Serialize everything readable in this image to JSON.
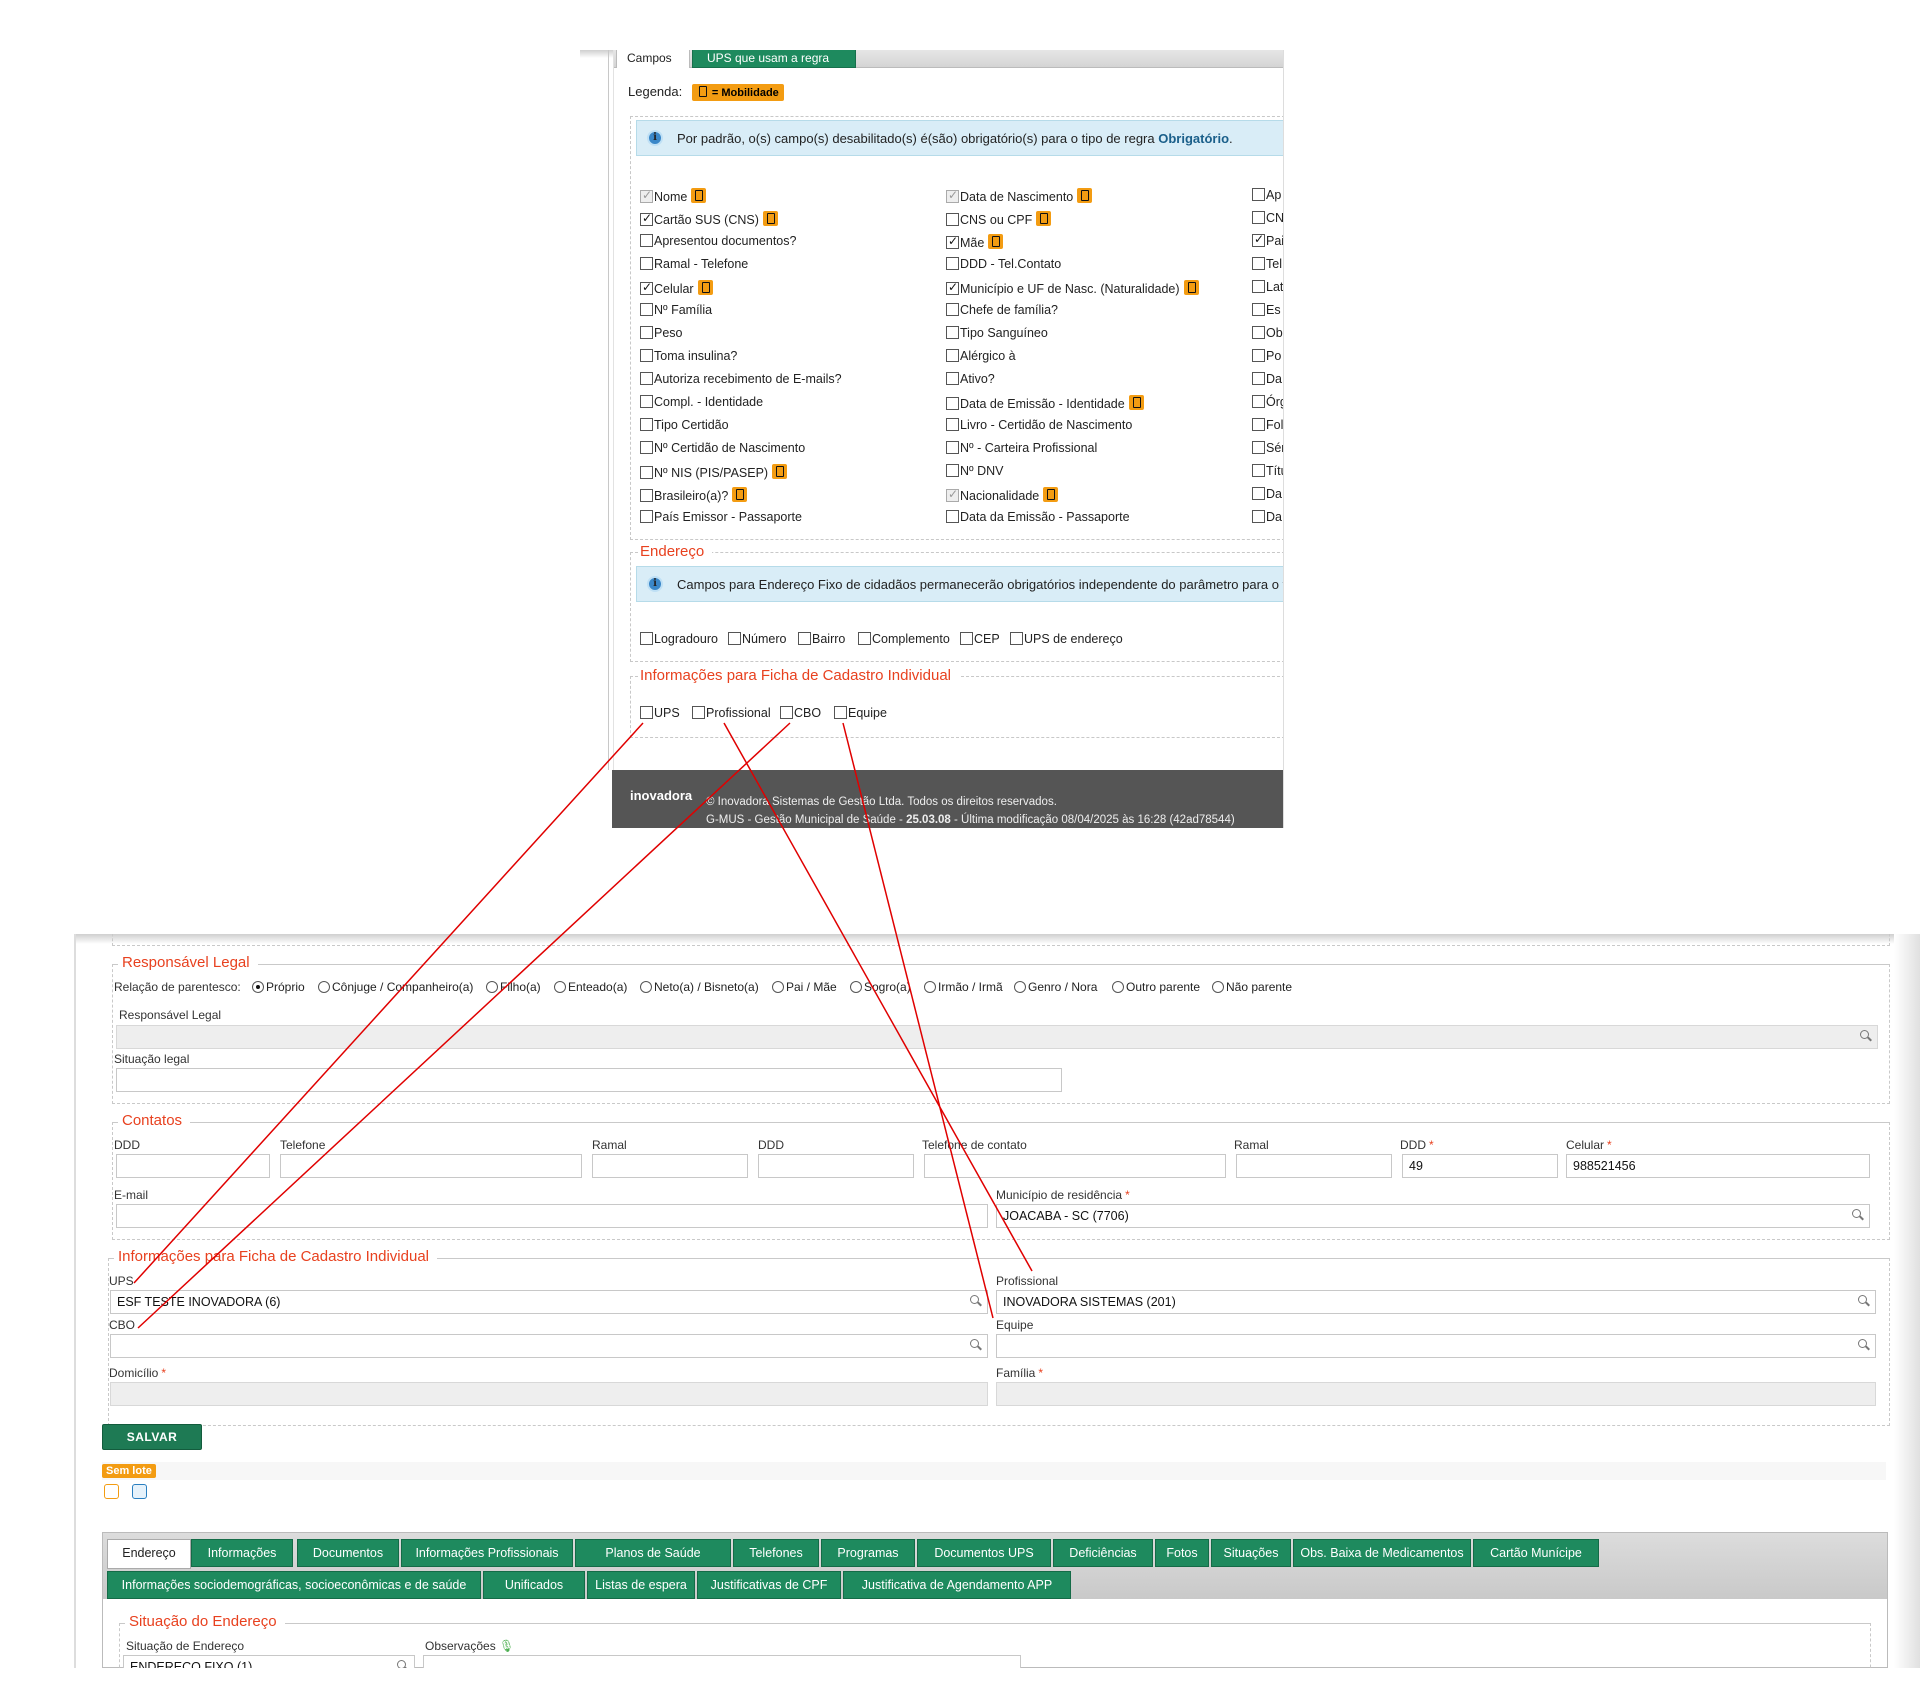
{
  "top": {
    "tabs": [
      {
        "label": "Campos"
      },
      {
        "label": "UPS que usam a regra"
      }
    ],
    "legenda_label": "Legenda:",
    "legenda_badge": "= Mobilidade",
    "info1_text": "Por padrão, o(s) campo(s) desabilitado(s) é(são) obrigatório(s) para o tipo de regra ",
    "info1_bold": "Obrigatório",
    "info1_end": ".",
    "col1": [
      {
        "label": "Nome",
        "checked": true,
        "disabled": true,
        "mob": true
      },
      {
        "label": "Cartão SUS (CNS)",
        "checked": true,
        "disabled": false,
        "mob": true
      },
      {
        "label": "Apresentou documentos?",
        "checked": false,
        "disabled": false,
        "mob": false
      },
      {
        "label": "Ramal - Telefone",
        "checked": false,
        "disabled": false,
        "mob": false
      },
      {
        "label": "Celular",
        "checked": true,
        "disabled": false,
        "mob": true
      },
      {
        "label": "Nº Família",
        "checked": false,
        "disabled": false,
        "mob": false
      },
      {
        "label": "Peso",
        "checked": false,
        "disabled": false,
        "mob": false
      },
      {
        "label": "Toma insulina?",
        "checked": false,
        "disabled": false,
        "mob": false
      },
      {
        "label": "Autoriza recebimento de E-mails?",
        "checked": false,
        "disabled": false,
        "mob": false
      },
      {
        "label": "Compl. - Identidade",
        "checked": false,
        "disabled": false,
        "mob": false
      },
      {
        "label": "Tipo Certidão",
        "checked": false,
        "disabled": false,
        "mob": false
      },
      {
        "label": "Nº Certidão de Nascimento",
        "checked": false,
        "disabled": false,
        "mob": false
      },
      {
        "label": "Nº NIS (PIS/PASEP)",
        "checked": false,
        "disabled": false,
        "mob": true
      },
      {
        "label": "Brasileiro(a)?",
        "checked": false,
        "disabled": false,
        "mob": true
      },
      {
        "label": "País Emissor - Passaporte",
        "checked": false,
        "disabled": false,
        "mob": false
      }
    ],
    "col2": [
      {
        "label": "Data de Nascimento",
        "checked": true,
        "disabled": true,
        "mob": true
      },
      {
        "label": "CNS ou CPF",
        "checked": false,
        "disabled": false,
        "mob": true
      },
      {
        "label": "Mãe",
        "checked": true,
        "disabled": false,
        "mob": true
      },
      {
        "label": "DDD - Tel.Contato",
        "checked": false,
        "disabled": false,
        "mob": false
      },
      {
        "label": "Município e UF de Nasc. (Naturalidade)",
        "checked": true,
        "disabled": false,
        "mob": true
      },
      {
        "label": "Chefe de família?",
        "checked": false,
        "disabled": false,
        "mob": false
      },
      {
        "label": "Tipo Sanguíneo",
        "checked": false,
        "disabled": false,
        "mob": false
      },
      {
        "label": "Alérgico à",
        "checked": false,
        "disabled": false,
        "mob": false
      },
      {
        "label": "Ativo?",
        "checked": false,
        "disabled": false,
        "mob": false
      },
      {
        "label": "Data de Emissão - Identidade",
        "checked": false,
        "disabled": false,
        "mob": true
      },
      {
        "label": "Livro - Certidão de Nascimento",
        "checked": false,
        "disabled": false,
        "mob": false
      },
      {
        "label": "Nº - Carteira Profissional",
        "checked": false,
        "disabled": false,
        "mob": false
      },
      {
        "label": "Nº DNV",
        "checked": false,
        "disabled": false,
        "mob": false
      },
      {
        "label": "Nacionalidade",
        "checked": true,
        "disabled": true,
        "mob": true
      },
      {
        "label": "Data da Emissão - Passaporte",
        "checked": false,
        "disabled": false,
        "mob": false
      }
    ],
    "col3": [
      {
        "label": "Ap",
        "checked": false
      },
      {
        "label": "CN",
        "checked": false
      },
      {
        "label": "Pai",
        "checked": true
      },
      {
        "label": "Tel",
        "checked": false
      },
      {
        "label": "Lat",
        "checked": false
      },
      {
        "label": "Es",
        "checked": false
      },
      {
        "label": "Ob",
        "checked": false
      },
      {
        "label": "Po",
        "checked": false
      },
      {
        "label": "Da",
        "checked": false
      },
      {
        "label": "Órg",
        "checked": false
      },
      {
        "label": "Fol",
        "checked": false
      },
      {
        "label": "Sér",
        "checked": false
      },
      {
        "label": "Títu",
        "checked": false
      },
      {
        "label": "Da",
        "checked": false
      },
      {
        "label": "Da",
        "checked": false
      }
    ],
    "endereco_title": "Endereço",
    "info2_text": "Campos para Endereço Fixo de cidadãos permanecerão obrigatórios independente do parâmetro para o t",
    "endereco_fields": [
      "Logradouro",
      "Número",
      "Bairro",
      "Complemento",
      "CEP",
      "UPS de endereço"
    ],
    "ficha_title": "Informações para Ficha de Cadastro Individual",
    "ficha_fields": [
      "UPS",
      "Profissional",
      "CBO",
      "Equipe"
    ],
    "footer_logo": "inovadora",
    "footer_line1": "© Inovadora Sistemas de Gestão Ltda. Todos os direitos reservados.",
    "footer_line2_a": "G-MUS - Gestão Municipal de Saúde - ",
    "footer_line2_b": "25.03.08",
    "footer_line2_c": " - Última modificação 08/04/2025 às 16:28 (42ad78544)"
  },
  "bottom": {
    "responsavel": {
      "title": "Responsável Legal",
      "relacao_label": "Relação de parentesco:",
      "options": [
        "Próprio",
        "Cônjuge / Companheiro(a)",
        "Filho(a)",
        "Enteado(a)",
        "Neto(a) / Bisneto(a)",
        "Pai / Mãe",
        "Sogro(a)",
        "Irmão / Irmã",
        "Genro / Nora",
        "Outro parente",
        "Não parente"
      ],
      "selected": "Próprio",
      "resp_label": "Responsável Legal",
      "situacao_label": "Situação legal"
    },
    "contatos": {
      "title": "Contatos",
      "ddd1_label": "DDD",
      "telefone_label": "Telefone",
      "ramal1_label": "Ramal",
      "ddd2_label": "DDD",
      "tel_contato_label": "Telefone de contato",
      "ramal2_label": "Ramal",
      "ddd3_label": "DDD",
      "ddd3_value": "49",
      "celular_label": "Celular",
      "celular_value": "988521456",
      "email_label": "E-mail",
      "municipio_label": "Município de residência",
      "municipio_value": "JOACABA - SC (7706)"
    },
    "ficha": {
      "title": "Informações para Ficha de Cadastro Individual",
      "ups_label": "UPS",
      "ups_value": "ESF TESTE INOVADORA (6)",
      "profissional_label": "Profissional",
      "profissional_value": "INOVADORA SISTEMAS (201)",
      "cbo_label": "CBO",
      "equipe_label": "Equipe",
      "domicilio_label": "Domicílio",
      "familia_label": "Família"
    },
    "salvar_label": "SALVAR",
    "lote_badge": "Sem lote",
    "tabs_row1": [
      "Endereço",
      "Informações",
      "Documentos",
      "Informações Profissionais",
      "Planos de Saúde",
      "Telefones",
      "Programas",
      "Documentos UPS",
      "Deficiências",
      "Fotos",
      "Situações",
      "Obs. Baixa de Medicamentos",
      "Cartão Munícipe"
    ],
    "tabs_row2": [
      "Informações sociodemográficas, socioeconômicas e de saúde",
      "Unificados",
      "Listas de espera",
      "Justificativas de CPF",
      "Justificativa de Agendamento APP"
    ],
    "situacao_endereco": {
      "title": "Situação do Endereço",
      "situacao_label": "Situação de Endereço",
      "situacao_value": "ENDEREÇO FIXO (1)",
      "obs_label": "Observações"
    }
  },
  "colors": {
    "accent_green": "#1e8a5e",
    "section_red": "#e8411f",
    "mob_orange": "#f39c12",
    "annotation_red": "#e00000"
  }
}
